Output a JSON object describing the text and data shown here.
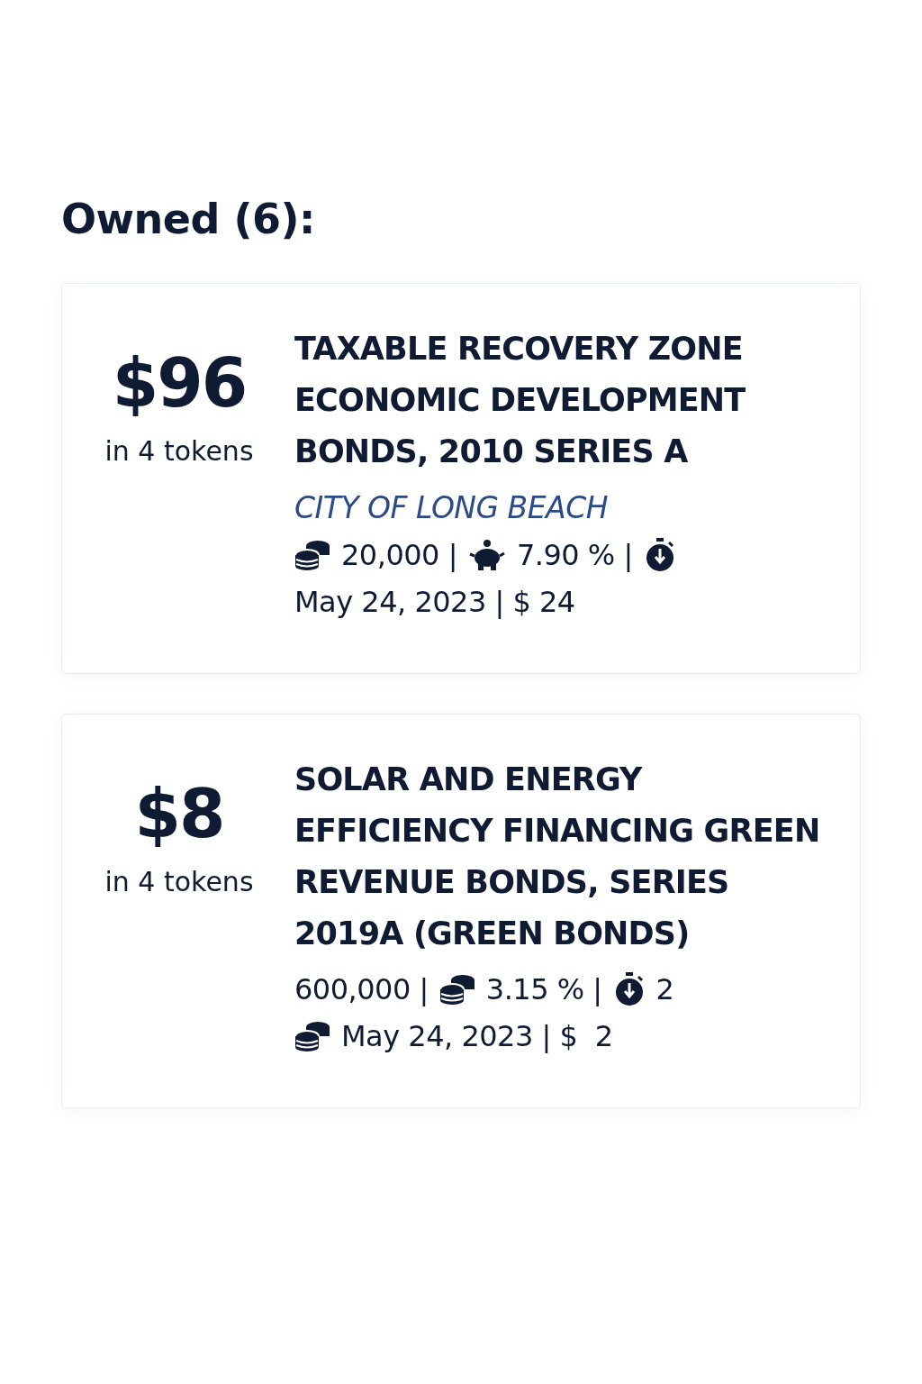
{
  "heading": "Owned (6):",
  "cards": [
    {
      "amount": "$96",
      "tokens": "in 4 tokens",
      "title": "TAXABLE RECOVERY ZONE ECONOMIC DEVELOPMENT BONDS, 2010 SERIES A",
      "issuer": "CITY OF LONG BEACH",
      "lines": [
        [
          {
            "kind": "coins"
          },
          {
            "kind": "text",
            "text": "20,000 |"
          },
          {
            "kind": "piggy"
          },
          {
            "kind": "text",
            "text": "7.90 % |"
          },
          {
            "kind": "stopwatch"
          }
        ],
        [
          {
            "kind": "text",
            "text": "May 24, 2023 | $ 24"
          }
        ]
      ]
    },
    {
      "amount": "$8",
      "tokens": "in 4 tokens",
      "title": "SOLAR AND ENERGY EFFICIENCY FINANCING GREEN REVENUE BONDS, SERIES 2019A (GREEN BONDS)",
      "lines": [
        [
          {
            "kind": "text",
            "text": "600,000 |"
          },
          {
            "kind": "coins"
          },
          {
            "kind": "text",
            "text": "3.15 % |"
          },
          {
            "kind": "stopwatch"
          },
          {
            "kind": "text",
            "text": "2"
          }
        ],
        [
          {
            "kind": "coins"
          },
          {
            "kind": "text",
            "text": "May 24, 2023 | $  2"
          }
        ]
      ]
    }
  ]
}
